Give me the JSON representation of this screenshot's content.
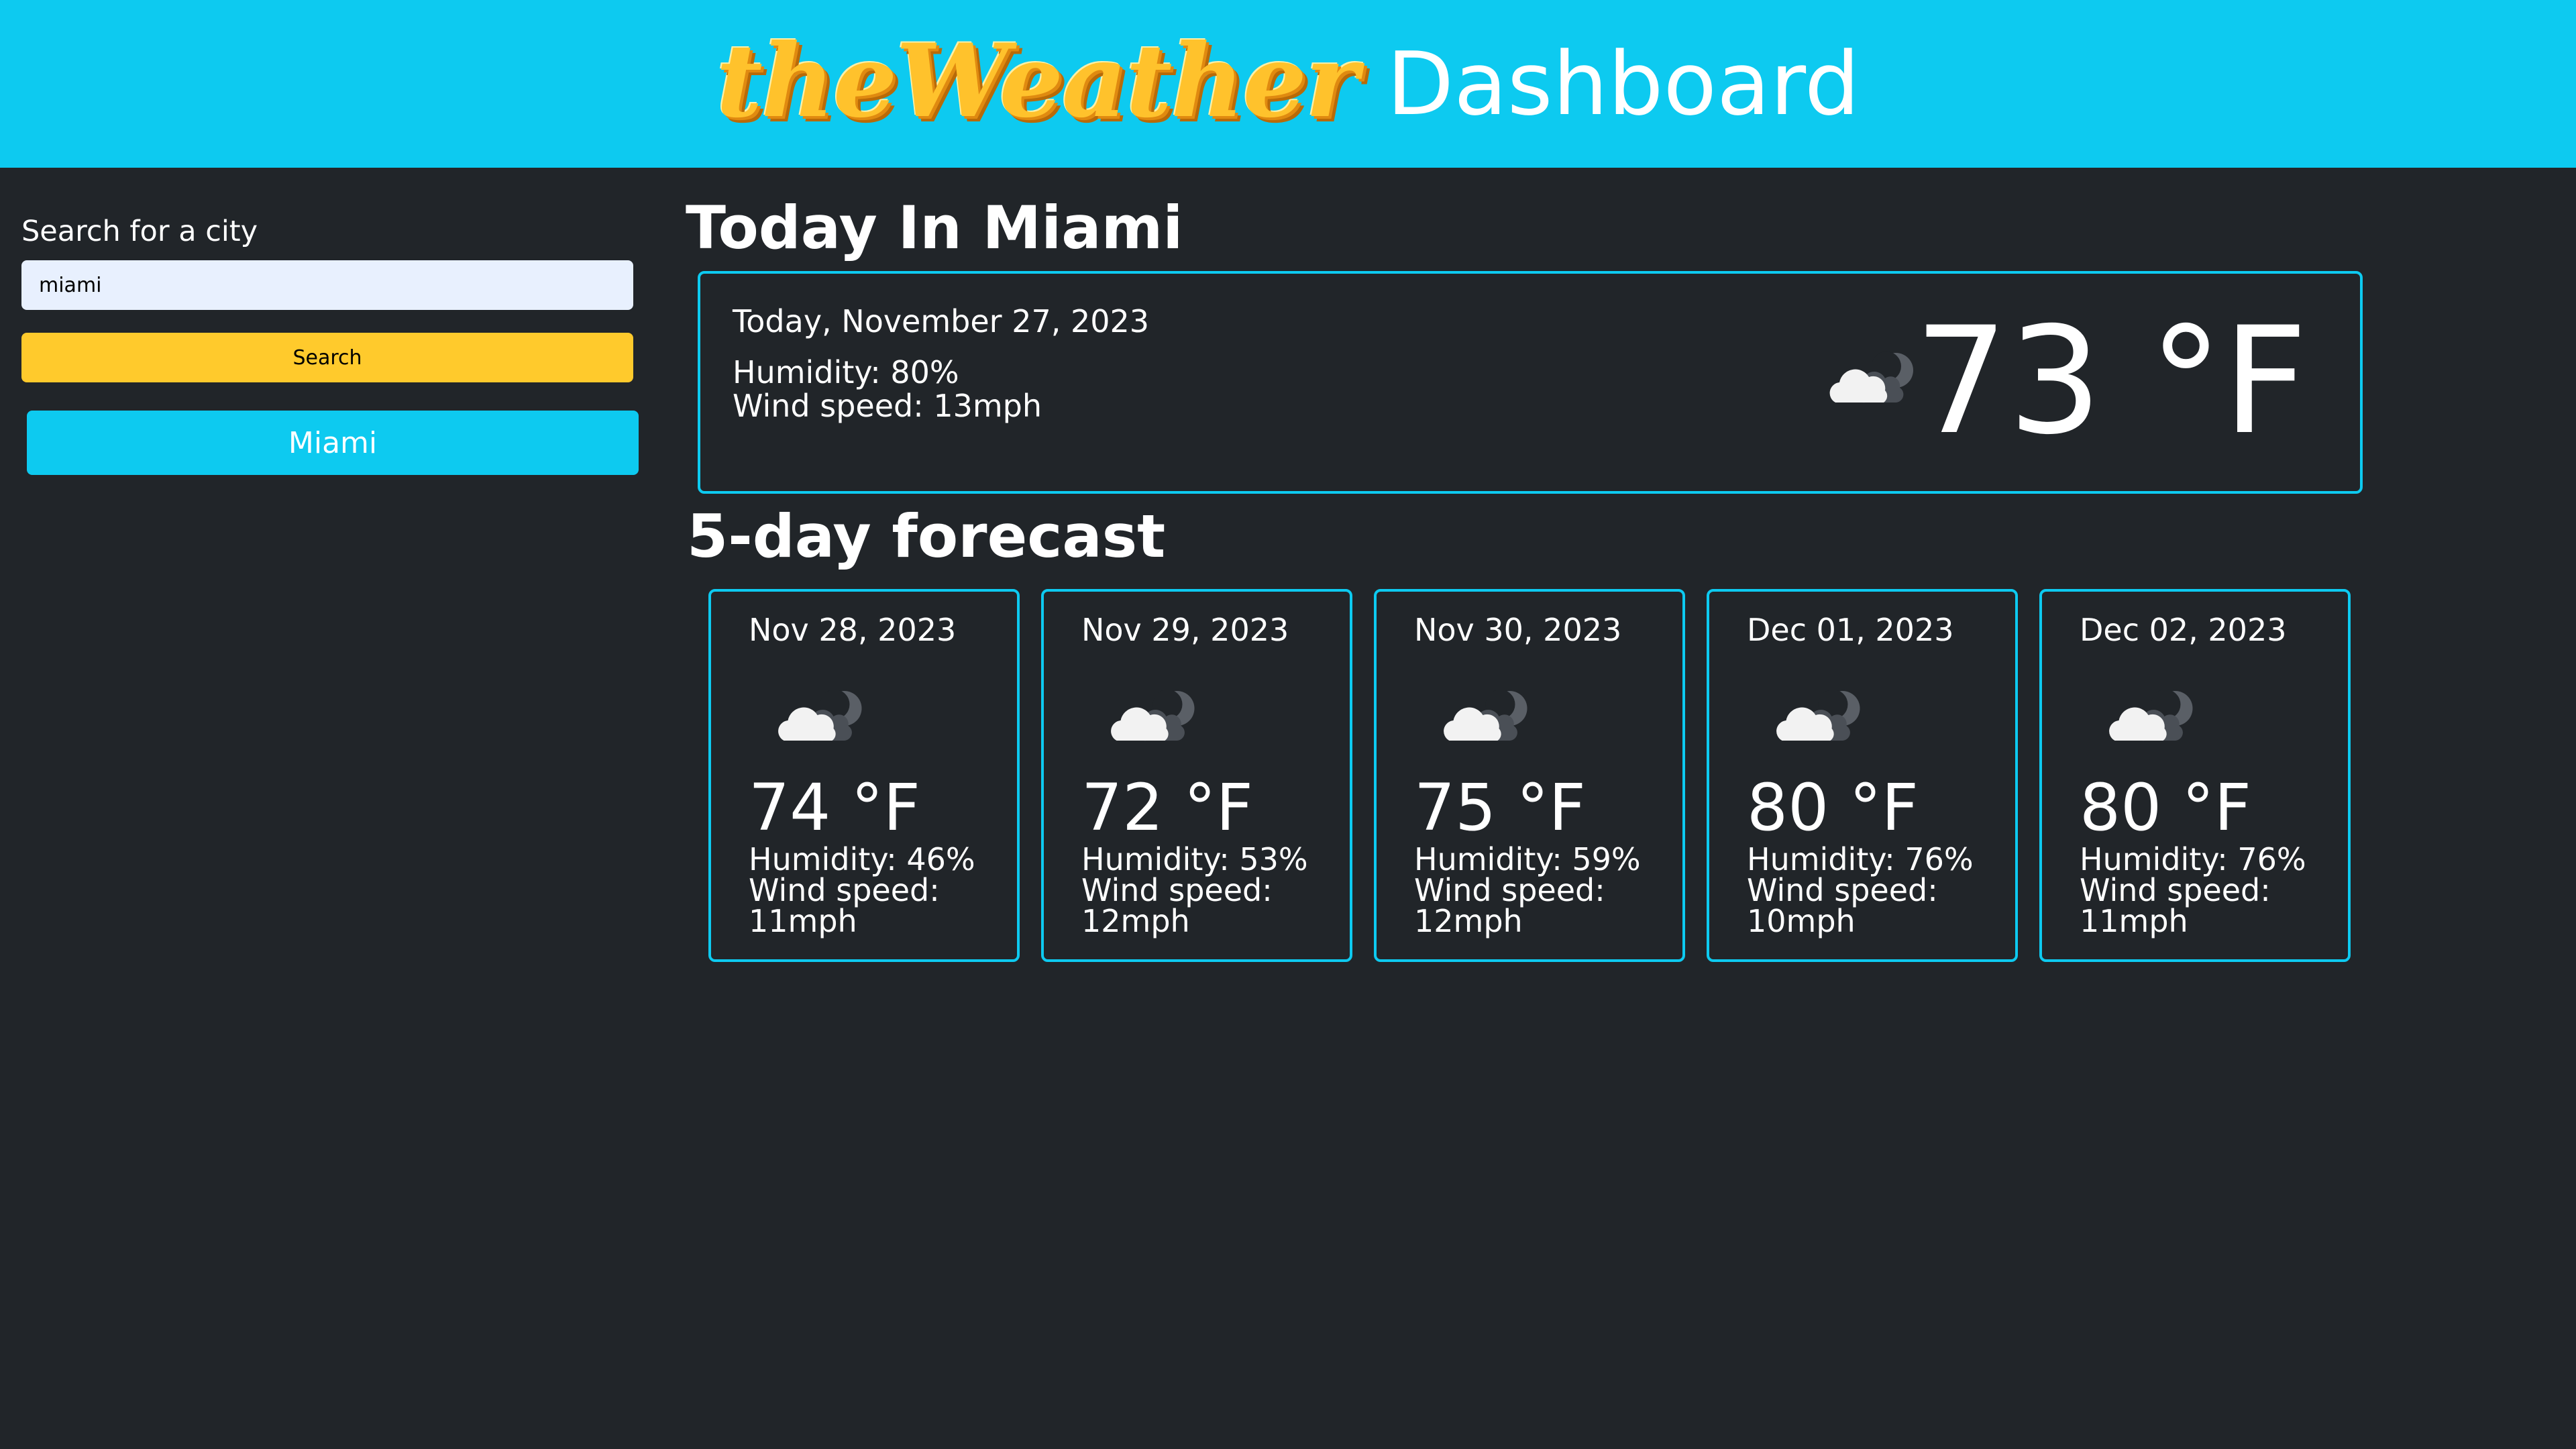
{
  "header": {
    "logo_text": "theWeather",
    "title": "Dashboard"
  },
  "sidebar": {
    "search_label": "Search for a city",
    "search_value": "miami",
    "search_button": "Search",
    "history": [
      "Miami"
    ]
  },
  "today": {
    "heading": "Today In Miami",
    "date": "Today, November 27, 2023",
    "humidity": "Humidity: 80%",
    "wind": "Wind speed: 13mph",
    "temp": "73 °F",
    "icon": "partly-cloudy-night-icon"
  },
  "forecast": {
    "heading": "5-day forecast",
    "days": [
      {
        "date": "Nov 28, 2023",
        "temp": "74 °F",
        "humidity": "Humidity: 46%",
        "wind_label": "Wind speed:",
        "wind_value": "11mph",
        "icon": "partly-cloudy-night-icon"
      },
      {
        "date": "Nov 29, 2023",
        "temp": "72 °F",
        "humidity": "Humidity: 53%",
        "wind_label": "Wind speed:",
        "wind_value": "12mph",
        "icon": "partly-cloudy-night-icon"
      },
      {
        "date": "Nov 30, 2023",
        "temp": "75 °F",
        "humidity": "Humidity: 59%",
        "wind_label": "Wind speed:",
        "wind_value": "12mph",
        "icon": "partly-cloudy-night-icon"
      },
      {
        "date": "Dec 01, 2023",
        "temp": "80 °F",
        "humidity": "Humidity: 76%",
        "wind_label": "Wind speed:",
        "wind_value": "10mph",
        "icon": "partly-cloudy-night-icon"
      },
      {
        "date": "Dec 02, 2023",
        "temp": "80 °F",
        "humidity": "Humidity: 76%",
        "wind_label": "Wind speed:",
        "wind_value": "11mph",
        "icon": "partly-cloudy-night-icon"
      }
    ]
  },
  "colors": {
    "header_bg": "#0dcaf0",
    "page_bg": "#212529",
    "search_button": "#ffca2c",
    "card_border": "#0dcaf0"
  }
}
